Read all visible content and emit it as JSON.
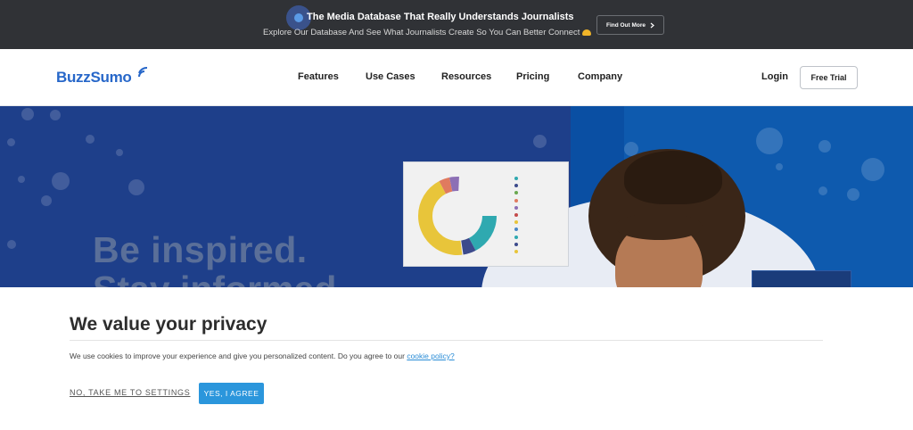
{
  "announcement": {
    "headline": "The Media Database That Really Understands Journalists",
    "subline": "Explore Our Database And See What Journalists Create So You Can Better Connect",
    "cta_label": "Find Out More"
  },
  "nav": {
    "logo_text": "BuzzSumo",
    "items": [
      {
        "label": "Features"
      },
      {
        "label": "Use Cases"
      },
      {
        "label": "Resources"
      },
      {
        "label": "Pricing"
      },
      {
        "label": "Company"
      }
    ],
    "login_label": "Login",
    "free_trial_label": "Free Trial"
  },
  "hero": {
    "headline_line1": "Be inspired.",
    "headline_line2": "Stay informed."
  },
  "cookie": {
    "title": "We value your privacy",
    "text": "We use cookies to improve your experience and give you personalized content. Do you agree to our",
    "link_text": "cookie policy?",
    "settings_label": "NO, TAKE ME TO SETTINGS",
    "agree_label": "YES, I AGREE"
  },
  "colors": {
    "topbar_bg": "#303236",
    "brand_blue": "#2767c9",
    "hero_bg": "#1e3f8a",
    "agree_button": "#2b96dc"
  }
}
